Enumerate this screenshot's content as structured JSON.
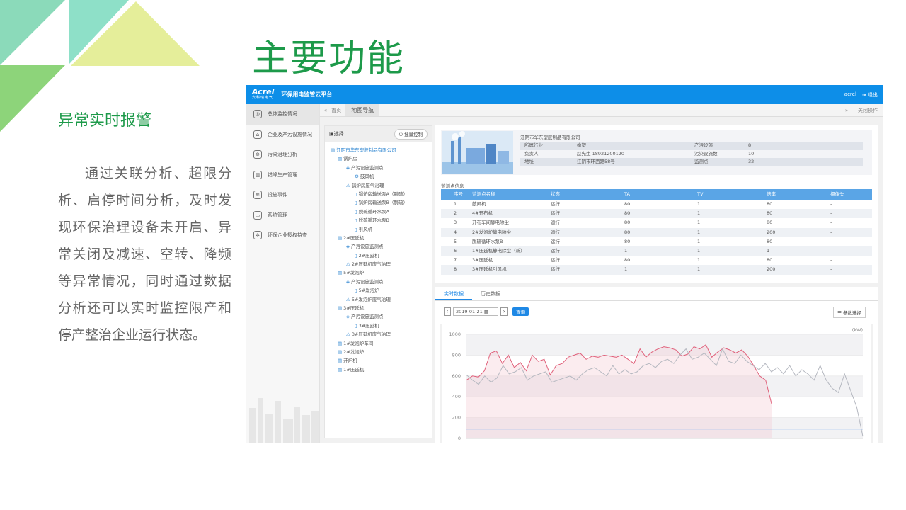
{
  "slide": {
    "title": "主要功能",
    "subtitle": "异常实时报警",
    "description": "通过关联分析、超限分析、启停时间分析，及时发现环保治理设备未开启、异常关闭及减速、空转、降频等异常情况，同时通过数据分析还可以实时监控限产和停产整治企业运行状态。",
    "colors": {
      "accent": "#1d9a4a",
      "app_blue": "#0d8ee8"
    }
  },
  "app": {
    "logo": "Acrel",
    "logo_sub": "安科瑞电气",
    "title": "环保用电监管云平台",
    "user": "acrel",
    "logout": "退出",
    "tabbar": {
      "home": "首页",
      "current_tab": "地图导航",
      "close_ops": "关闭操作"
    },
    "sidebar": [
      {
        "label": "总体监控情况",
        "icon": "dashboard-icon",
        "glyph": "◎"
      },
      {
        "label": "企业及产污设施情况",
        "icon": "factory-icon",
        "glyph": "⌂"
      },
      {
        "label": "污染治理分析",
        "icon": "target-icon",
        "glyph": "⊕"
      },
      {
        "label": "错峰生产管理",
        "icon": "building-icon",
        "glyph": "▥"
      },
      {
        "label": "设施事件",
        "icon": "signal-icon",
        "glyph": "≋"
      },
      {
        "label": "系统管理",
        "icon": "monitor-icon",
        "glyph": "▭"
      },
      {
        "label": "环保企业授权持查",
        "icon": "gear-icon",
        "glyph": "✲"
      }
    ],
    "tree": {
      "header": "选择",
      "batch_button": "批量控制",
      "nodes": [
        "江阴市华东塑胶制品有限公司",
        "锅炉房",
        "产污设施监测点",
        "鼓风机",
        "锅炉房废气治理",
        "锅炉房输送泵A（脱硫）",
        "锅炉房输送泵B（脱硫）",
        "脱硫循环水泵A",
        "脱硫循环水泵B",
        "引风机",
        "2#压延机",
        "产污设施监测点",
        "2#压延机",
        "2#压延机废气治理",
        "5#发泡炉",
        "产污设施监测点",
        "5#发泡炉",
        "5#发泡炉废气治理",
        "3#压延机",
        "产污设施监测点",
        "3#压延机",
        "3#压延机废气治理",
        "1#发泡炉车间",
        "2#发泡炉",
        "开炉机",
        "1#压延机"
      ]
    },
    "company": {
      "name": "江阴市华东塑胶制品有限公司",
      "rows": [
        [
          "所属行业",
          "橡塑",
          "产污设施",
          "8"
        ],
        [
          "负责人",
          "赵先生 18921200120",
          "污染设施数",
          "10"
        ],
        [
          "地址",
          "江阴市环西路58号",
          "监测点",
          "32"
        ]
      ]
    },
    "monitor_label": "监测点信息",
    "monitor_table": {
      "headers": [
        "序号",
        "监测点名称",
        "状态",
        "TA",
        "TV",
        "倍率",
        "摄像头"
      ],
      "rows": [
        [
          "1",
          "鼓风机",
          "运行",
          "80",
          "1",
          "80",
          "-"
        ],
        [
          "2",
          "4#开布机",
          "运行",
          "80",
          "1",
          "80",
          "-"
        ],
        [
          "3",
          "开布车间静电除尘",
          "运行",
          "80",
          "1",
          "80",
          "-"
        ],
        [
          "4",
          "2#发泡炉静电除尘",
          "运行",
          "80",
          "1",
          "200",
          "-"
        ],
        [
          "5",
          "脱硫循环水泵B",
          "运行",
          "80",
          "1",
          "80",
          "-"
        ],
        [
          "6",
          "1#压延机静电除尘（新）",
          "运行",
          "1",
          "1",
          "1",
          "-"
        ],
        [
          "7",
          "3#压延机",
          "运行",
          "80",
          "1",
          "80",
          "-"
        ],
        [
          "8",
          "3#压延机引风机",
          "运行",
          "1",
          "1",
          "200",
          "-"
        ]
      ]
    },
    "data_tabs": [
      "实时数据",
      "历史数据"
    ],
    "date_value": "2019-01-21",
    "query_button": "查询",
    "param_button": "参数选择"
  },
  "chart_data": {
    "type": "line",
    "ylabel": "(kW)",
    "ylim": [
      0,
      1000
    ],
    "yticks": [
      "1000",
      "800",
      "600",
      "400",
      "200",
      "0"
    ],
    "x": [
      0,
      1,
      2,
      3,
      4,
      5,
      6,
      7,
      8,
      9,
      10,
      11,
      12,
      13,
      14,
      15,
      16,
      17,
      18,
      19,
      20,
      21,
      22,
      23,
      24,
      25,
      26,
      27,
      28,
      29,
      30,
      31,
      32,
      33,
      34,
      35,
      36,
      37,
      38,
      39,
      40,
      41,
      42,
      43,
      44,
      45,
      46,
      47,
      48,
      49,
      50,
      51,
      52,
      53,
      54,
      55,
      56,
      57,
      58,
      59,
      60
    ],
    "series": [
      {
        "color": "#e0607a",
        "values": [
          560,
          600,
          590,
          650,
          820,
          840,
          720,
          800,
          680,
          730,
          650,
          800,
          740,
          760,
          610,
          700,
          720,
          780,
          800,
          820,
          760,
          790,
          780,
          800,
          790,
          780,
          800,
          760,
          720,
          860,
          780,
          830,
          860,
          880,
          870,
          850,
          790,
          810,
          880,
          860,
          900,
          780,
          830,
          870,
          850,
          820,
          850,
          790,
          700,
          600,
          560,
          330
        ]
      },
      {
        "color": "#b5b8c0",
        "values": [
          610,
          560,
          520,
          600,
          540,
          580,
          700,
          620,
          640,
          680,
          560,
          600,
          620,
          640,
          540,
          560,
          580,
          600,
          560,
          620,
          660,
          680,
          640,
          600,
          700,
          620,
          660,
          620,
          640,
          700,
          720,
          680,
          740,
          760,
          720,
          800,
          860,
          760,
          780,
          820,
          760,
          700,
          860,
          740,
          720,
          800,
          740,
          700,
          660,
          720,
          640,
          680,
          620,
          700,
          600,
          660,
          620,
          560,
          700,
          560,
          480,
          440,
          620,
          460,
          300,
          20
        ]
      },
      {
        "color": "#8fb7f0",
        "values": [
          90,
          90,
          90,
          90,
          90,
          90,
          90,
          90,
          90,
          90,
          90,
          90,
          90,
          90,
          90,
          90,
          90,
          90,
          90,
          90,
          90,
          90,
          90,
          90,
          90,
          90,
          90,
          90,
          90,
          90,
          90,
          90,
          90,
          90,
          90,
          90,
          90,
          90,
          90,
          90,
          90,
          90,
          90,
          90,
          90,
          90,
          90,
          90,
          90,
          90,
          90,
          90,
          90,
          90,
          90,
          90,
          90,
          90,
          90,
          90,
          90,
          90,
          90,
          90,
          90,
          90
        ]
      }
    ]
  }
}
